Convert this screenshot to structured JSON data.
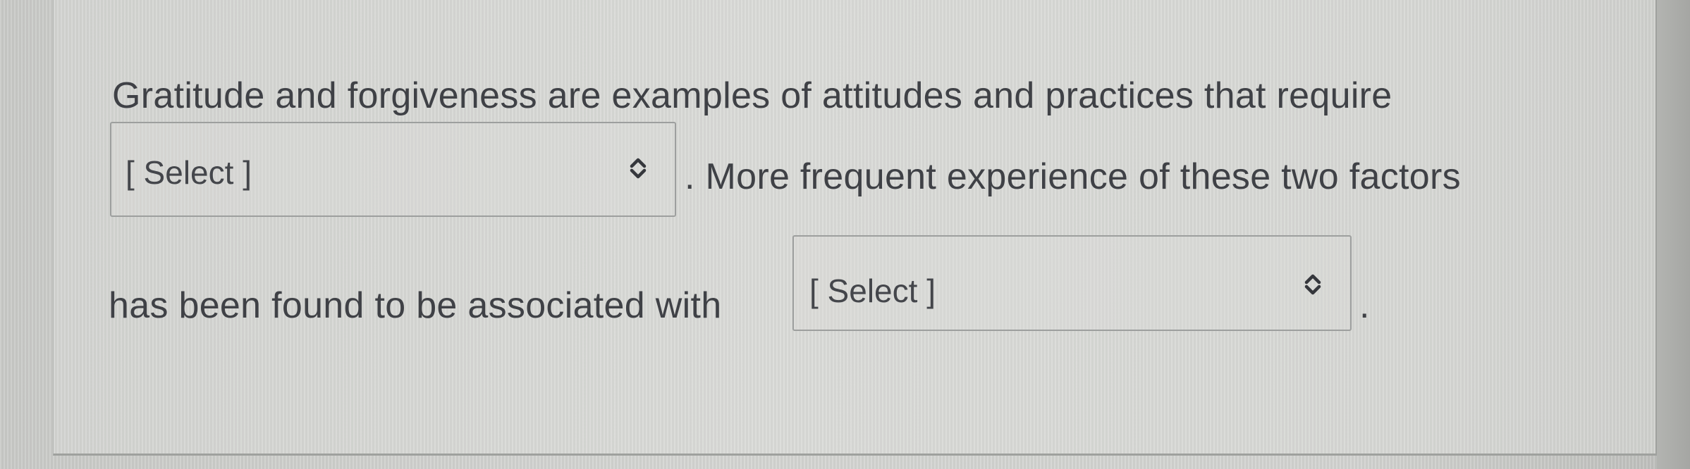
{
  "question": {
    "line1": "Gratitude and forgiveness are examples of attitudes and practices that require",
    "line2_after_select": ". More frequent experience of these two factors",
    "line3_before_select": "has been found to be associated with",
    "line3_end": "."
  },
  "selects": [
    {
      "value": "[ Select ]",
      "icon": "up-down-chevron-icon"
    },
    {
      "value": "[ Select ]",
      "icon": "up-down-chevron-icon"
    }
  ]
}
